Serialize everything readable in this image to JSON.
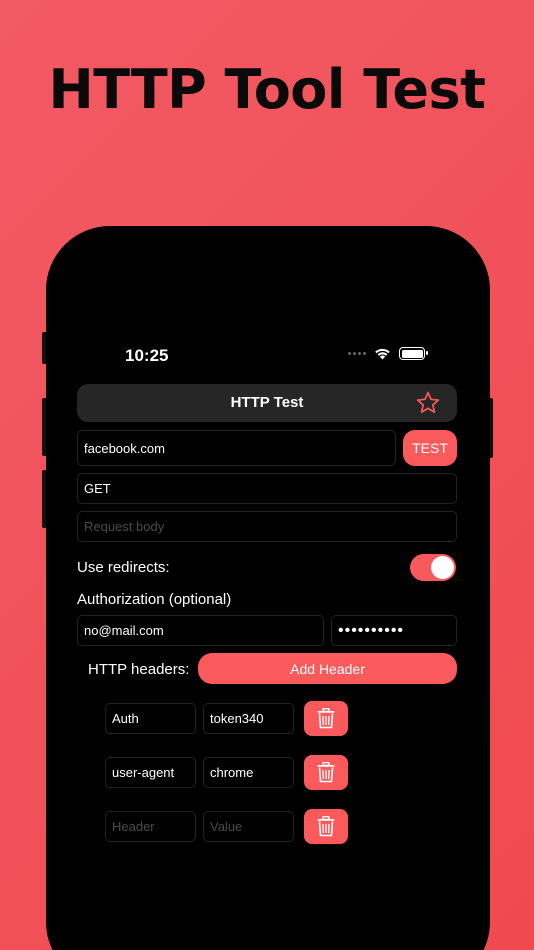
{
  "headline": "HTTP Tool Test",
  "status": {
    "time": "10:25"
  },
  "nav": {
    "title": "HTTP Test"
  },
  "request": {
    "url": "facebook.com",
    "test_label": "TEST",
    "method": "GET",
    "body_placeholder": "Request body"
  },
  "redirects": {
    "label": "Use redirects:",
    "enabled": true
  },
  "auth": {
    "label": "Authorization (optional)",
    "username": "no@mail.com",
    "password": "••••••••••"
  },
  "headers": {
    "label": "HTTP headers:",
    "add_label": "Add Header",
    "rows": [
      {
        "key": "Auth",
        "value": "token340"
      },
      {
        "key": "user-agent",
        "value": "chrome"
      }
    ],
    "key_placeholder": "Header",
    "value_placeholder": "Value"
  },
  "colors": {
    "accent": "#fa5a5c",
    "background": "#f25a64",
    "phone": "#000000"
  }
}
